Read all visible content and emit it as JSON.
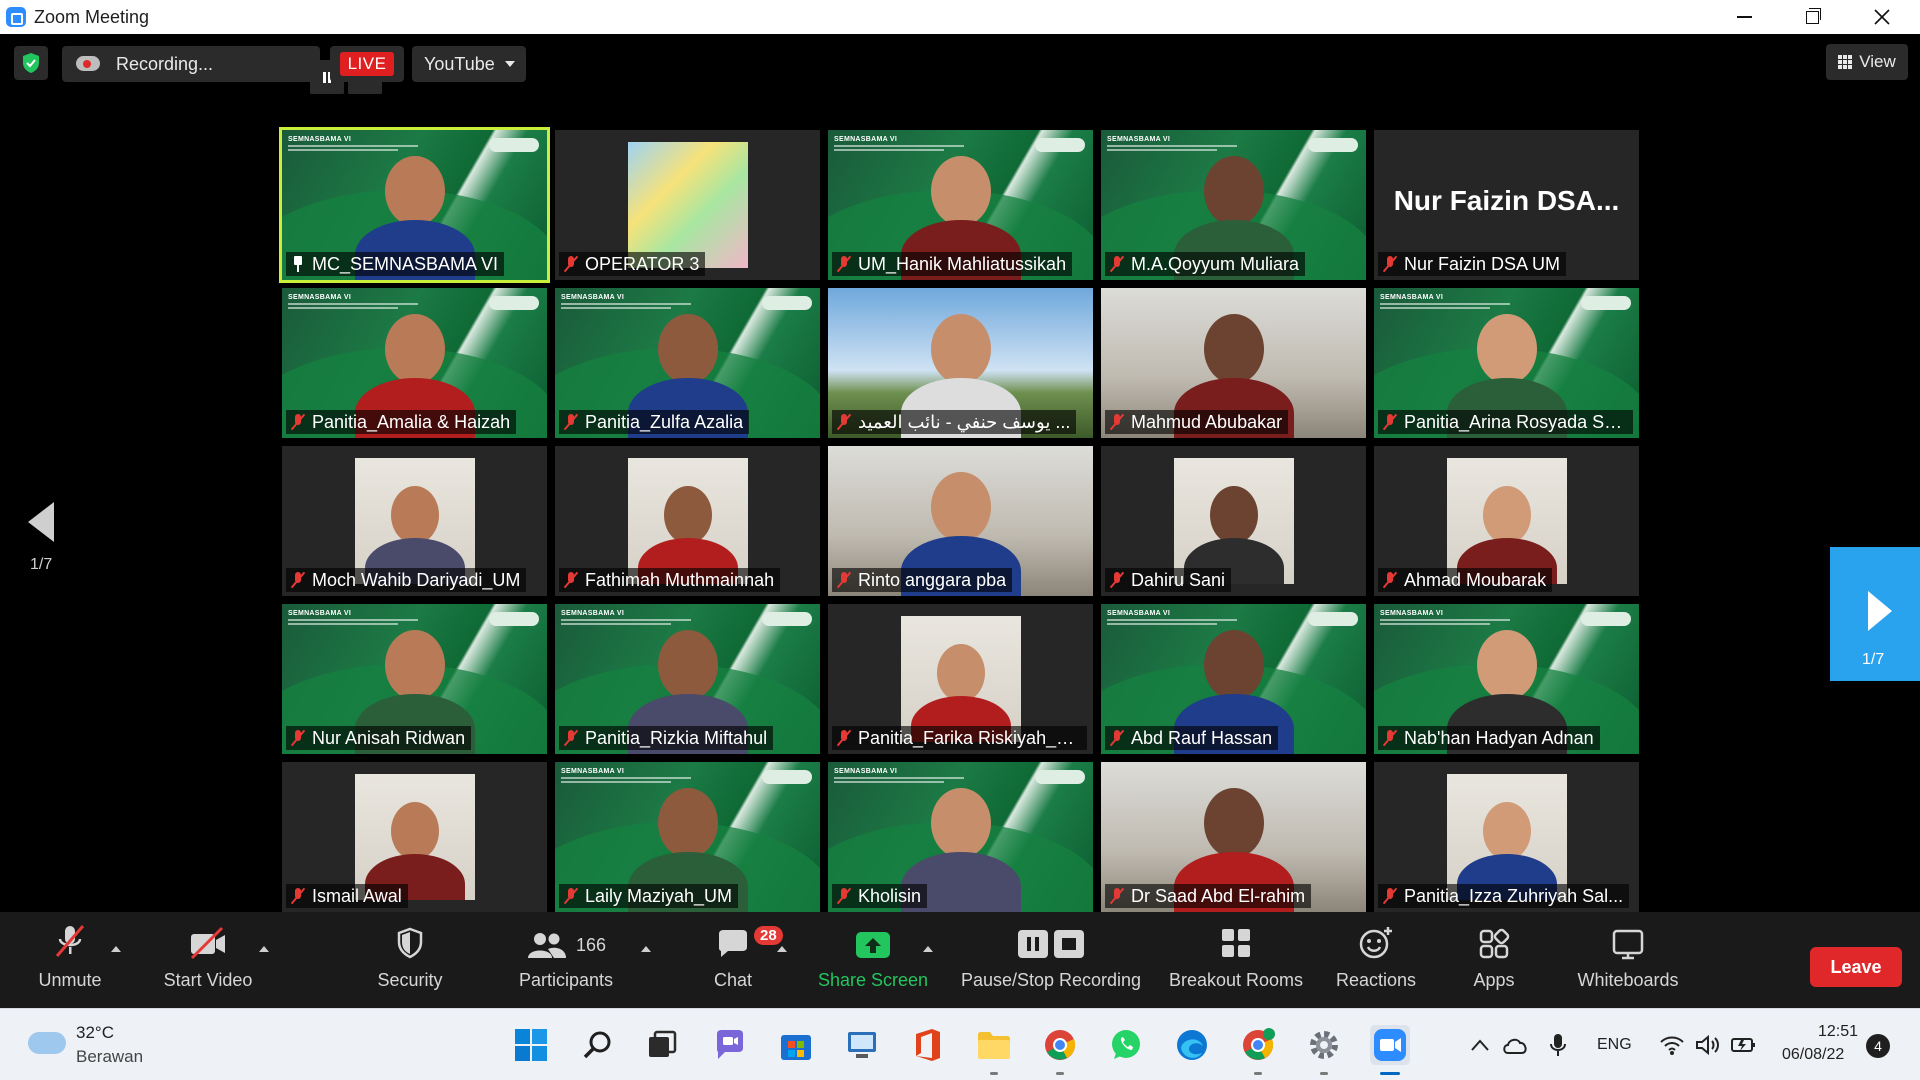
{
  "window": {
    "title": "Zoom Meeting"
  },
  "recording": {
    "label": "Recording..."
  },
  "live": {
    "label": "LIVE",
    "platform": "YouTube"
  },
  "view": {
    "label": "View"
  },
  "pagination": {
    "left": "1/7",
    "right": "1/7"
  },
  "participants": [
    {
      "name": "MC_SEMNASBAMA VI",
      "state": "pinned",
      "bg": "green"
    },
    {
      "name": "OPERATOR 3",
      "state": "muted",
      "bg": "cartoon"
    },
    {
      "name": "UM_Hanik Mahliatussikah",
      "state": "muted",
      "bg": "green"
    },
    {
      "name": "M.A.Qoyyum Muliara",
      "state": "muted",
      "bg": "green"
    },
    {
      "name": "Nur Faizin DSA UM",
      "state": "muted",
      "bg": "dark",
      "title": "Nur Faizin DSA..."
    },
    {
      "name": "Panitia_Amalia & Haizah",
      "state": "muted",
      "bg": "green"
    },
    {
      "name": "Panitia_Zulfa Azalia",
      "state": "muted",
      "bg": "green"
    },
    {
      "name": "يوسف حنفي - نائب العميد ...",
      "state": "muted",
      "bg": "outdoor"
    },
    {
      "name": "Mahmud Abubakar",
      "state": "muted",
      "bg": "room"
    },
    {
      "name": "Panitia_Arina Rosyada Saj...",
      "state": "muted",
      "bg": "green"
    },
    {
      "name": "Moch Wahib Dariyadi_UM",
      "state": "muted",
      "bg": "portrait"
    },
    {
      "name": "Fathimah Muthmainnah",
      "state": "muted",
      "bg": "portrait"
    },
    {
      "name": "Rinto anggara pba",
      "state": "muted",
      "bg": "room"
    },
    {
      "name": "Dahiru Sani",
      "state": "muted",
      "bg": "portrait"
    },
    {
      "name": "Ahmad Moubarak",
      "state": "muted",
      "bg": "portrait"
    },
    {
      "name": "Nur Anisah Ridwan",
      "state": "muted",
      "bg": "green"
    },
    {
      "name": "Panitia_Rizkia Miftahul",
      "state": "muted",
      "bg": "green"
    },
    {
      "name": "Panitia_Farika Riskiyah_Se...",
      "state": "muted",
      "bg": "portrait"
    },
    {
      "name": "Abd Rauf Hassan",
      "state": "muted",
      "bg": "green"
    },
    {
      "name": "Nab'han Hadyan Adnan",
      "state": "muted",
      "bg": "green"
    },
    {
      "name": "Ismail Awal",
      "state": "muted",
      "bg": "portrait"
    },
    {
      "name": "Laily Maziyah_UM",
      "state": "muted",
      "bg": "green"
    },
    {
      "name": "Kholisin",
      "state": "muted",
      "bg": "green"
    },
    {
      "name": "Dr Saad Abd El-rahim",
      "state": "muted",
      "bg": "room"
    },
    {
      "name": "Panitia_Izza Zuhriyah Sal...",
      "state": "muted",
      "bg": "portrait"
    }
  ],
  "banner_text": "SEMNASBAMA VI",
  "toolbar": {
    "unmute": "Unmute",
    "start_video": "Start Video",
    "security": "Security",
    "participants": "Participants",
    "participants_count": "166",
    "chat": "Chat",
    "chat_badge": "28",
    "share_screen": "Share Screen",
    "pause_stop_recording": "Pause/Stop Recording",
    "breakout_rooms": "Breakout Rooms",
    "reactions": "Reactions",
    "apps": "Apps",
    "whiteboards": "Whiteboards",
    "leave": "Leave"
  },
  "taskbar": {
    "weather_temp": "32°C",
    "weather_desc": "Berawan",
    "language": "ENG",
    "time": "12:51",
    "date": "06/08/22",
    "notifications": "4"
  },
  "colors": {
    "active_speaker": "#c9ef3a",
    "live": "#e02020",
    "muted_mic": "#e53935",
    "share_screen": "#22c55e",
    "leave": "#e0282b",
    "nav_next": "#2aa3ef"
  }
}
